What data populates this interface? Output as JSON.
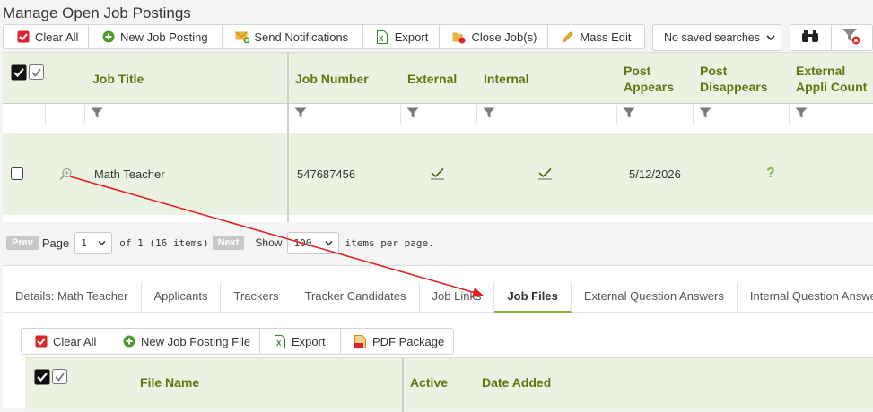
{
  "page": {
    "title": "Manage Open Job Postings"
  },
  "toolbar": {
    "clear_all": "Clear All",
    "new_job_posting": "New Job Posting",
    "send_notifications": "Send Notifications",
    "export": "Export",
    "close_jobs": "Close Job(s)",
    "mass_edit": "Mass Edit",
    "saved_searches": "No saved searches"
  },
  "grid": {
    "columns": {
      "job_title": "Job Title",
      "job_number": "Job Number",
      "external": "External",
      "internal": "Internal",
      "post_appears": "Post Appears",
      "post_disappears": "Post Disappears",
      "external_applicant_count": "External Appli Count"
    },
    "row": {
      "job_title": "Math Teacher",
      "job_number": "547687456",
      "external": "checked",
      "internal": "checked",
      "post_appears": "5/12/2026",
      "post_disappears": "?"
    }
  },
  "pager": {
    "prev": "Prev",
    "page_label": "Page",
    "page_value": "1",
    "of_text": "of 1 (16 items)",
    "next": "Next",
    "show_label": "Show",
    "per_page_value": "100",
    "per_page_text": "items per page."
  },
  "detail_tabs": [
    {
      "label": "Details: Math Teacher"
    },
    {
      "label": "Applicants"
    },
    {
      "label": "Trackers"
    },
    {
      "label": "Tracker Candidates"
    },
    {
      "label": "Job Links"
    },
    {
      "label": "Job Files",
      "active": true
    },
    {
      "label": "External Question Answers"
    },
    {
      "label": "Internal Question Answers"
    }
  ],
  "files_toolbar": {
    "clear_all": "Clear All",
    "new_job_posting_file": "New Job Posting File",
    "export": "Export",
    "pdf_package": "PDF Package"
  },
  "files_grid": {
    "columns": {
      "file_name": "File Name",
      "active": "Active",
      "date_added": "Date Added"
    }
  },
  "colors": {
    "accent_green": "#5a7a10",
    "header_bg": "#ecf2e2",
    "annotation_arrow": "#dd2222"
  }
}
